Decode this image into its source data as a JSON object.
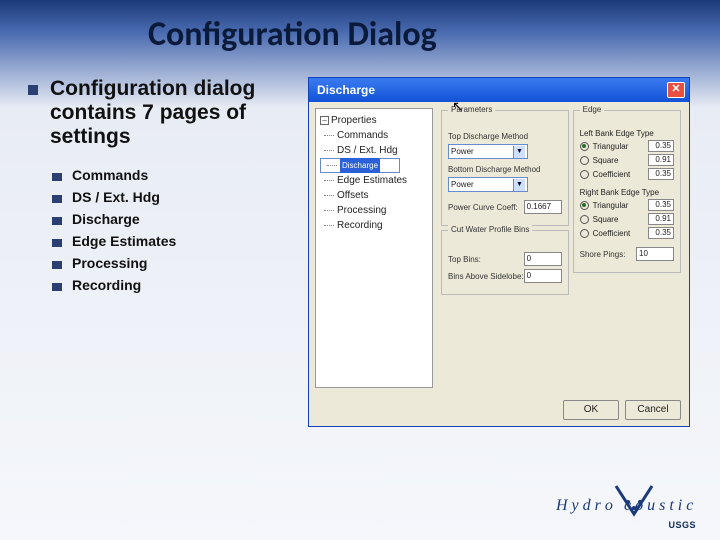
{
  "slide": {
    "title": "Configuration Dialog",
    "bullet_main": "Configuration dialog contains 7 pages of settings",
    "sub_bullets": [
      "Commands",
      "DS / Ext. Hdg",
      "Discharge",
      "Edge Estimates",
      "Processing",
      "Recording"
    ]
  },
  "dialog": {
    "title": "Discharge",
    "close_glyph": "✕",
    "tree": {
      "root": "Properties",
      "items": [
        "Commands",
        "DS / Ext. Hdg",
        "Discharge",
        "Edge Estimates",
        "Offsets",
        "Processing",
        "Recording"
      ],
      "selected": "Discharge"
    },
    "parameters": {
      "group_label": "Parameters",
      "top_method_label": "Top Discharge Method",
      "top_method_value": "Power",
      "bottom_method_label": "Bottom Discharge Method",
      "bottom_method_value": "Power",
      "power_coeff_label": "Power Curve Coeff:",
      "power_coeff_value": "0.1667",
      "cut_group_label": "Cut Water Profile Bins",
      "top_bins_label": "Top Bins:",
      "top_bins_value": "0",
      "bins_above_label": "Bins Above Sidelobe:",
      "bins_above_value": "0"
    },
    "edge": {
      "group_label": "Edge",
      "left_label": "Left Bank Edge Type",
      "right_label": "Right Bank Edge Type",
      "options": [
        {
          "label": "Triangular",
          "value": "0.35"
        },
        {
          "label": "Square",
          "value": "0.91"
        },
        {
          "label": "Coefficient",
          "value": "0.35"
        }
      ],
      "left_selected": 0,
      "right_selected": 0,
      "shore_pings_label": "Shore Pings:",
      "shore_pings_value": "10"
    },
    "buttons": {
      "ok": "OK",
      "cancel": "Cancel"
    }
  },
  "footer": {
    "brand": "Hydroacoustics",
    "usgs": "USGS"
  }
}
